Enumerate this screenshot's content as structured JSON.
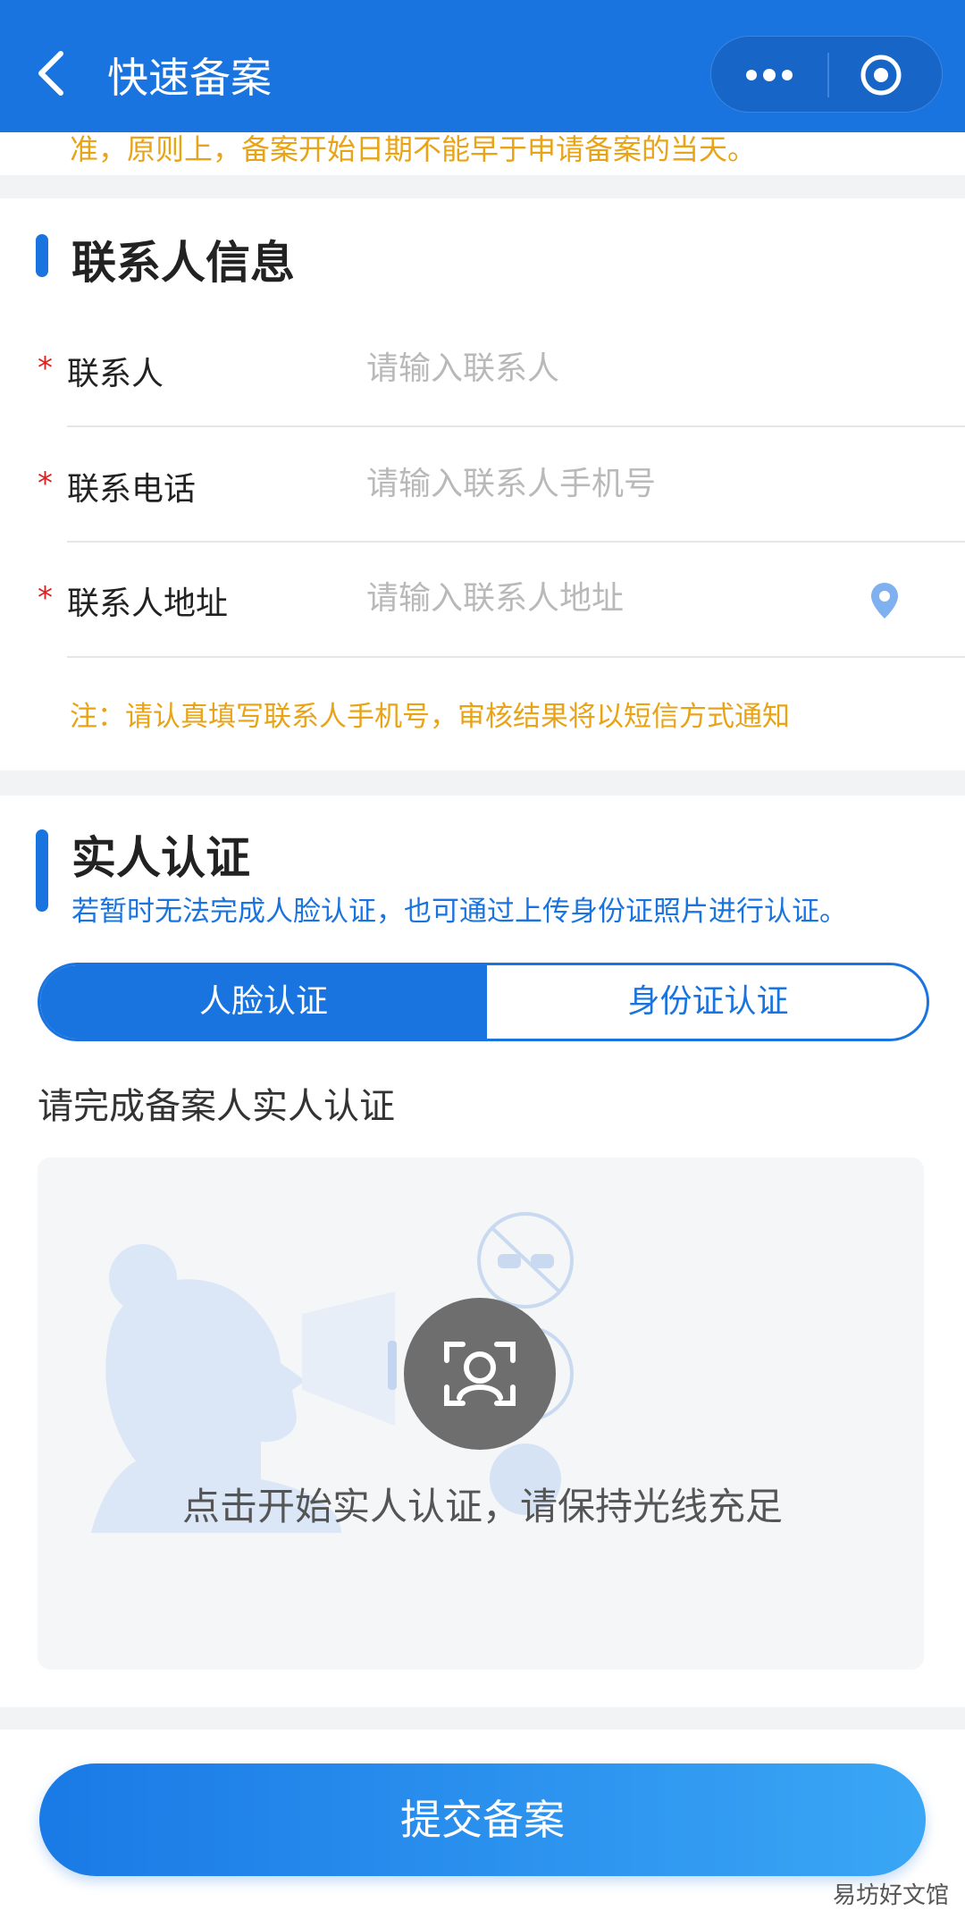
{
  "navbar": {
    "title": "快速备案"
  },
  "notice_strip": {
    "text": "准，原则上，备案开始日期不能早于申请备案的当天。"
  },
  "contact": {
    "title": "联系人信息",
    "fields": [
      {
        "required": "*",
        "label": "联系人",
        "placeholder": "请输入联系人"
      },
      {
        "required": "*",
        "label": "联系电话",
        "placeholder": "请输入联系人手机号"
      },
      {
        "required": "*",
        "label": "联系人地址",
        "placeholder": "请输入联系人地址"
      }
    ],
    "note": "注：请认真填写联系人手机号，审核结果将以短信方式通知"
  },
  "verify": {
    "title": "实人认证",
    "subtitle": "若暂时无法完成人脸认证，也可通过上传身份证照片进行认证。",
    "tabs": [
      {
        "label": "人脸认证",
        "active": true
      },
      {
        "label": "身份证认证",
        "active": false
      }
    ],
    "prompt": "请完成备案人实人认证",
    "hint": "点击开始实人认证，请保持光线充足"
  },
  "submit": {
    "label": "提交备案"
  },
  "watermark": "易坊好文馆",
  "colors": {
    "primary": "#1a74df",
    "warning": "#e8a317",
    "required": "#d8231f"
  }
}
